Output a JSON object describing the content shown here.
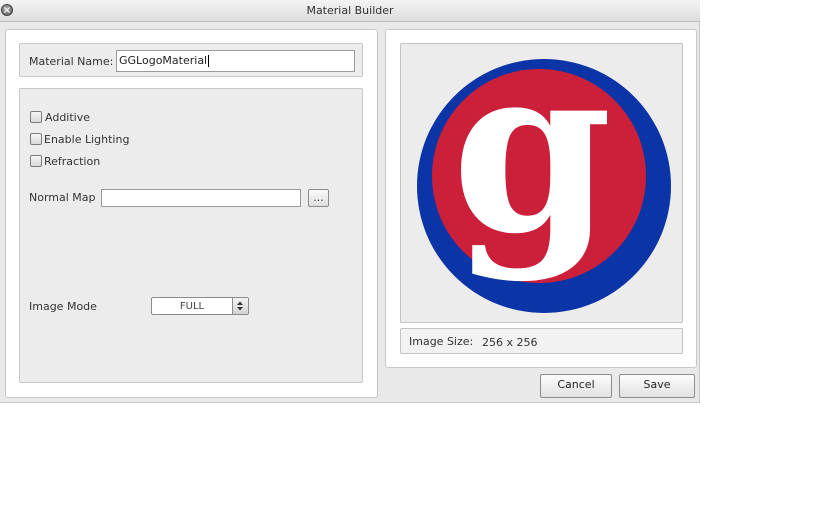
{
  "window": {
    "title": "Material Builder"
  },
  "material_name": {
    "label": "Material Name:",
    "value": "GGLogoMaterial"
  },
  "options": [
    {
      "label": "Additive",
      "checked": false
    },
    {
      "label": "Enable Lighting",
      "checked": false
    },
    {
      "label": "Refraction",
      "checked": false
    }
  ],
  "normal_map": {
    "label": "Normal Map",
    "value": "",
    "browse_label": "..."
  },
  "image_mode": {
    "label": "Image Mode",
    "value": "FULL"
  },
  "preview": {
    "size_label": "Image Size:",
    "size_value": "256 x 256"
  },
  "logo": {
    "glyph": "g",
    "colors": {
      "outer": "#0b35a6",
      "inner": "#cc1f3a",
      "glyph": "#ffffff"
    }
  },
  "buttons": {
    "cancel": "Cancel",
    "save": "Save"
  }
}
